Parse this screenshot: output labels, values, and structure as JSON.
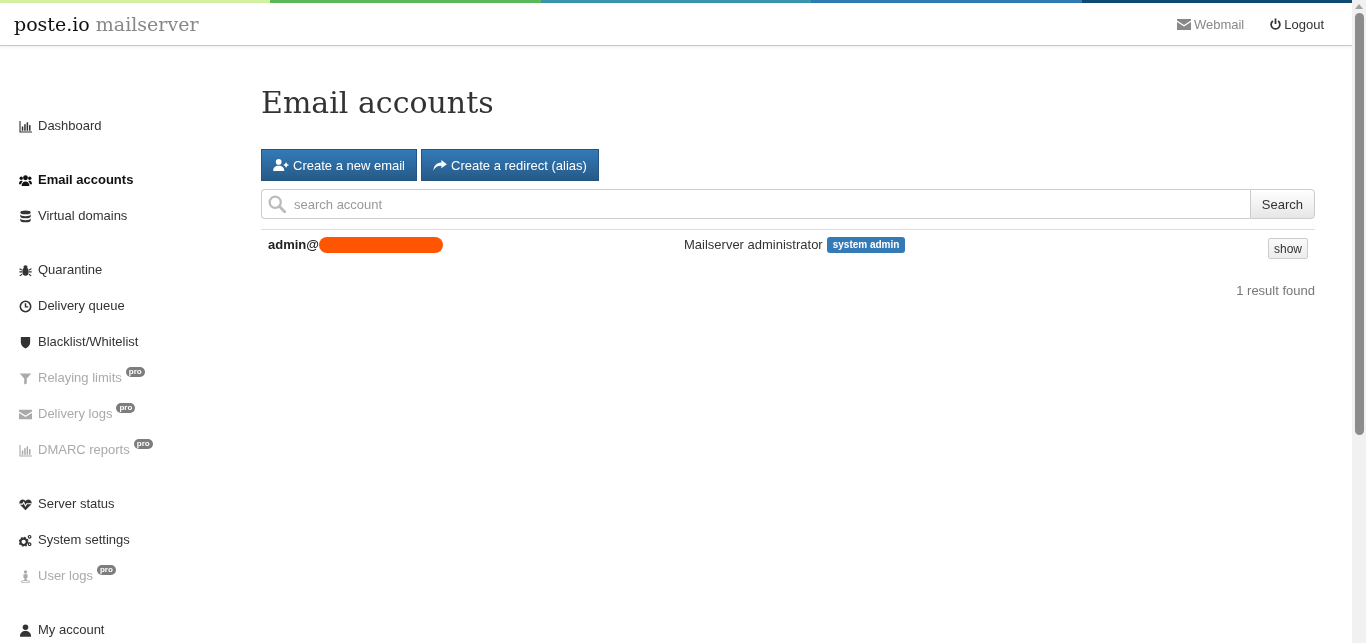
{
  "header": {
    "logo": {
      "brand": "poste.io",
      "product": "mailserver"
    },
    "links": [
      {
        "label": "Webmail",
        "muted": true
      },
      {
        "label": "Logout",
        "muted": false
      }
    ]
  },
  "sidebar": {
    "groups": [
      {
        "items": [
          {
            "label": "Dashboard",
            "selected": false,
            "disabled": false
          }
        ]
      },
      {
        "items": [
          {
            "label": "Email accounts",
            "selected": true,
            "disabled": false
          },
          {
            "label": "Virtual domains",
            "selected": false,
            "disabled": false
          }
        ]
      },
      {
        "items": [
          {
            "label": "Quarantine",
            "selected": false,
            "disabled": false
          },
          {
            "label": "Delivery queue",
            "selected": false,
            "disabled": false
          },
          {
            "label": "Blacklist/Whitelist",
            "selected": false,
            "disabled": false
          },
          {
            "label": "Relaying limits",
            "selected": false,
            "disabled": true,
            "badge": "pro"
          },
          {
            "label": "Delivery logs",
            "selected": false,
            "disabled": true,
            "badge": "pro"
          },
          {
            "label": "DMARC reports",
            "selected": false,
            "disabled": true,
            "badge": "pro"
          }
        ]
      },
      {
        "items": [
          {
            "label": "Server status",
            "selected": false,
            "disabled": false
          },
          {
            "label": "System settings",
            "selected": false,
            "disabled": false
          },
          {
            "label": "User logs",
            "selected": false,
            "disabled": true,
            "badge": "pro"
          }
        ]
      },
      {
        "items": [
          {
            "label": "My account",
            "selected": false,
            "disabled": false
          }
        ]
      }
    ]
  },
  "page": {
    "title": "Email accounts",
    "actions": [
      {
        "label": "Create a new email"
      },
      {
        "label": "Create a redirect (alias)"
      }
    ],
    "search": {
      "placeholder": "search account",
      "button": "Search"
    }
  },
  "accounts": {
    "rows": [
      {
        "email": "admin@",
        "redacted": true,
        "name": "Mailserver administrator",
        "badge": "system admin",
        "action": "show"
      }
    ],
    "result_count": "1 result found"
  }
}
